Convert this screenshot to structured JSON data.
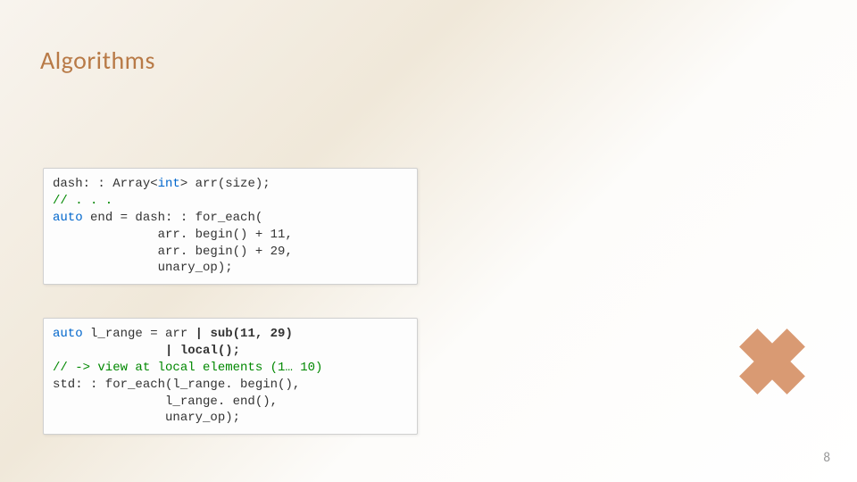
{
  "title": "Algorithms",
  "code1": {
    "ln1a": "dash: : Array<",
    "ln1b": "int",
    "ln1c": "> arr(size);",
    "ln2": "// . . .",
    "ln3a": "auto",
    "ln3b": " end = dash: : for_each(",
    "ln4": "              arr. begin() + 11,",
    "ln5": "              arr. begin() + 29,",
    "ln6": "              unary_op);"
  },
  "code2": {
    "ln1a": "auto",
    "ln1b": " l_range = arr ",
    "ln1c": "| sub(11, 29)",
    "ln2a": "               ",
    "ln2b": "| local();",
    "ln3": "// -> view at local elements (1… 10)",
    "ln4": "std: : for_each(l_range. begin(),",
    "ln5": "               l_range. end(),",
    "ln6": "               unary_op);"
  },
  "page_number": "8"
}
